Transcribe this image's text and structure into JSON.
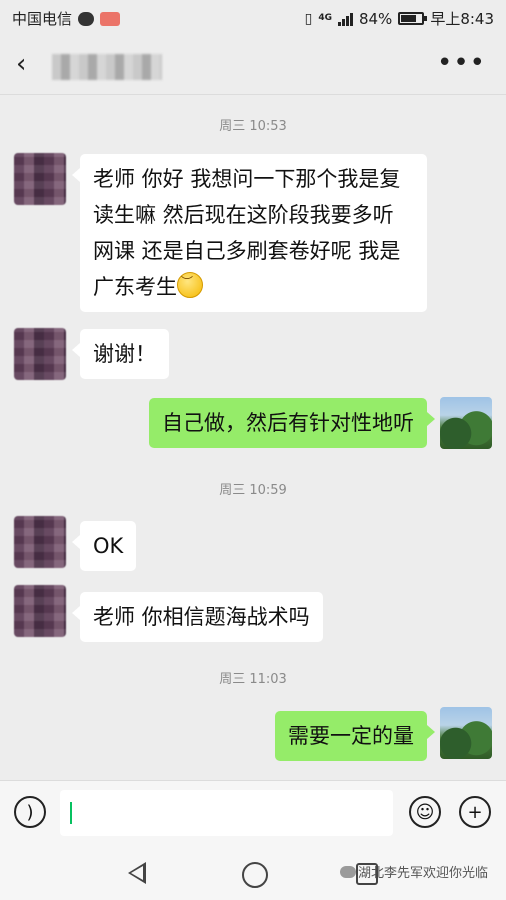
{
  "status_bar": {
    "carrier": "中国电信",
    "network": "4G",
    "battery": "84%",
    "battery_level": 0.84,
    "time": "早上8:43"
  },
  "header": {
    "title": "",
    "back_icon": "chevron-left-icon",
    "more_icon": "more-horizontal-icon"
  },
  "chat": {
    "timestamps": [
      "周三 10:53",
      "周三 10:59",
      "周三 11:03"
    ],
    "messages": [
      {
        "side": "left",
        "text": "老师 你好 我想问一下那个我是复读生嘛 然后现在这阶段我要多听网课 还是自己多刷套卷好呢 我是广东考生",
        "emoji": "smile-emoji-icon"
      },
      {
        "side": "left",
        "text": "谢谢！"
      },
      {
        "side": "right",
        "text": "自己做，然后有针对性地听"
      },
      {
        "side": "left",
        "text": "OK"
      },
      {
        "side": "left",
        "text": "老师 你相信题海战术吗"
      },
      {
        "side": "right",
        "text": "需要一定的量"
      }
    ]
  },
  "input_bar": {
    "voice_icon": "voice-icon",
    "emoji_icon": "emoji-icon",
    "add_icon": "plus-icon",
    "text": ""
  },
  "watermark": "湖北李先军欢迎你光临",
  "colors": {
    "background": "#ededed",
    "sent_bubble": "#95ec69",
    "received_bubble": "#ffffff",
    "caret": "#07c160"
  }
}
